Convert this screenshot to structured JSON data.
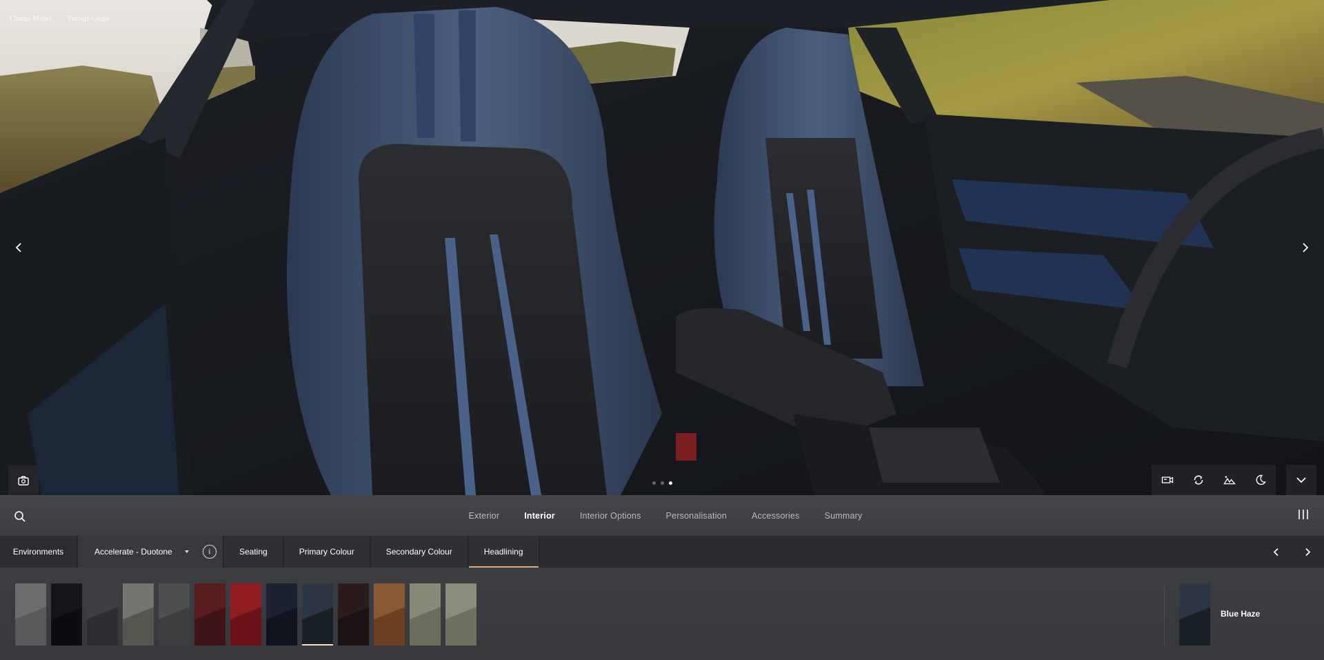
{
  "breadcrumb": {
    "items": [
      "Change Model",
      "Vantage Coupe"
    ],
    "separator": "›"
  },
  "viewer": {
    "prev_label": "Previous view",
    "next_label": "Next view",
    "pagination": {
      "count": 3,
      "active_index": 2
    },
    "tools": [
      {
        "name": "video-camera-icon",
        "label": "Video"
      },
      {
        "name": "rotate-icon",
        "label": "360 view"
      },
      {
        "name": "landscape-icon",
        "label": "Environment"
      },
      {
        "name": "moon-icon",
        "label": "Night mode"
      }
    ]
  },
  "main_nav": {
    "tabs": [
      {
        "label": "Exterior",
        "active": false
      },
      {
        "label": "Interior",
        "active": true
      },
      {
        "label": "Interior Options",
        "active": false
      },
      {
        "label": "Personalisation",
        "active": false
      },
      {
        "label": "Accessories",
        "active": false
      },
      {
        "label": "Summary",
        "active": false
      }
    ]
  },
  "sub_nav": {
    "environments_label": "Environments",
    "spec_select": {
      "value": "Accelerate - Duotone"
    },
    "info_glyph": "i",
    "tabs": [
      {
        "label": "Seating",
        "active": false
      },
      {
        "label": "Primary Colour",
        "active": false
      },
      {
        "label": "Secondary Colour",
        "active": false
      },
      {
        "label": "Headlining",
        "active": true
      }
    ]
  },
  "swatches": [
    {
      "top": "#6b6c6e",
      "bottom": "#58595b",
      "selected": false
    },
    {
      "top": "#141518",
      "bottom": "#0c0d10",
      "selected": false
    },
    {
      "top": "#3d3e41",
      "bottom": "#2d2e31",
      "selected": false
    },
    {
      "top": "#75756f",
      "bottom": "#56564f",
      "selected": false
    },
    {
      "top": "#4e4f51",
      "bottom": "#3c3d3f",
      "selected": false
    },
    {
      "top": "#5a1c1f",
      "bottom": "#3e1416",
      "selected": false
    },
    {
      "top": "#8e1c20",
      "bottom": "#6b1216",
      "selected": false
    },
    {
      "top": "#1b2130",
      "bottom": "#10141e",
      "selected": false
    },
    {
      "top": "#2d3645",
      "bottom": "#1a2028",
      "selected": true
    },
    {
      "top": "#2a1b1c",
      "bottom": "#1c1213",
      "selected": false
    },
    {
      "top": "#8a5a35",
      "bottom": "#6b3f22",
      "selected": false
    },
    {
      "top": "#8a8a78",
      "bottom": "#6b6c5c",
      "selected": false
    },
    {
      "top": "#8c8c7c",
      "bottom": "#6e7060",
      "selected": false
    }
  ],
  "selected_colour": {
    "name": "Blue Haze",
    "top": "#2d3645",
    "bottom": "#1a2028"
  }
}
